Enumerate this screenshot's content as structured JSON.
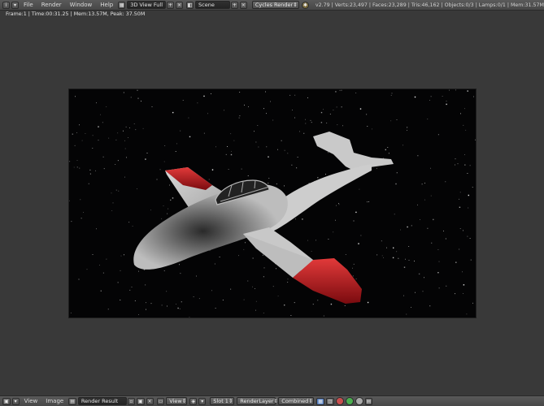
{
  "top_header": {
    "menus": [
      "File",
      "Render",
      "Window",
      "Help"
    ],
    "screen_layout": "3D View Full",
    "scene": "Scene",
    "render_engine": "Cycles Render",
    "stats": "v2.79 | Verts:23,497 | Faces:23,289 | Tris:46,162 | Objects:0/3 | Lamps:0/1 | Mem:31.57M"
  },
  "render_info": "Frame:1 | Time:00:31.25 | Mem:13.57M, Peak: 37.50M",
  "image_editor_footer": {
    "view_menu": "View",
    "image_menu": "Image",
    "image_name": "Render Result",
    "view_dropdown": "View",
    "slot": "Slot 1",
    "render_layer": "RenderLayer",
    "pass": "Combined"
  },
  "icons": {
    "info_editor": "info-icon",
    "layout_browse": "layout-browse-icon",
    "scene_browse": "scene-browse-icon",
    "editor_type": "image-editor-icon"
  },
  "colors": {
    "header_bg": "#505050",
    "editor_bg": "#393939",
    "wing_tip": "#b8131b",
    "fuselage": "#cfcfcf"
  }
}
